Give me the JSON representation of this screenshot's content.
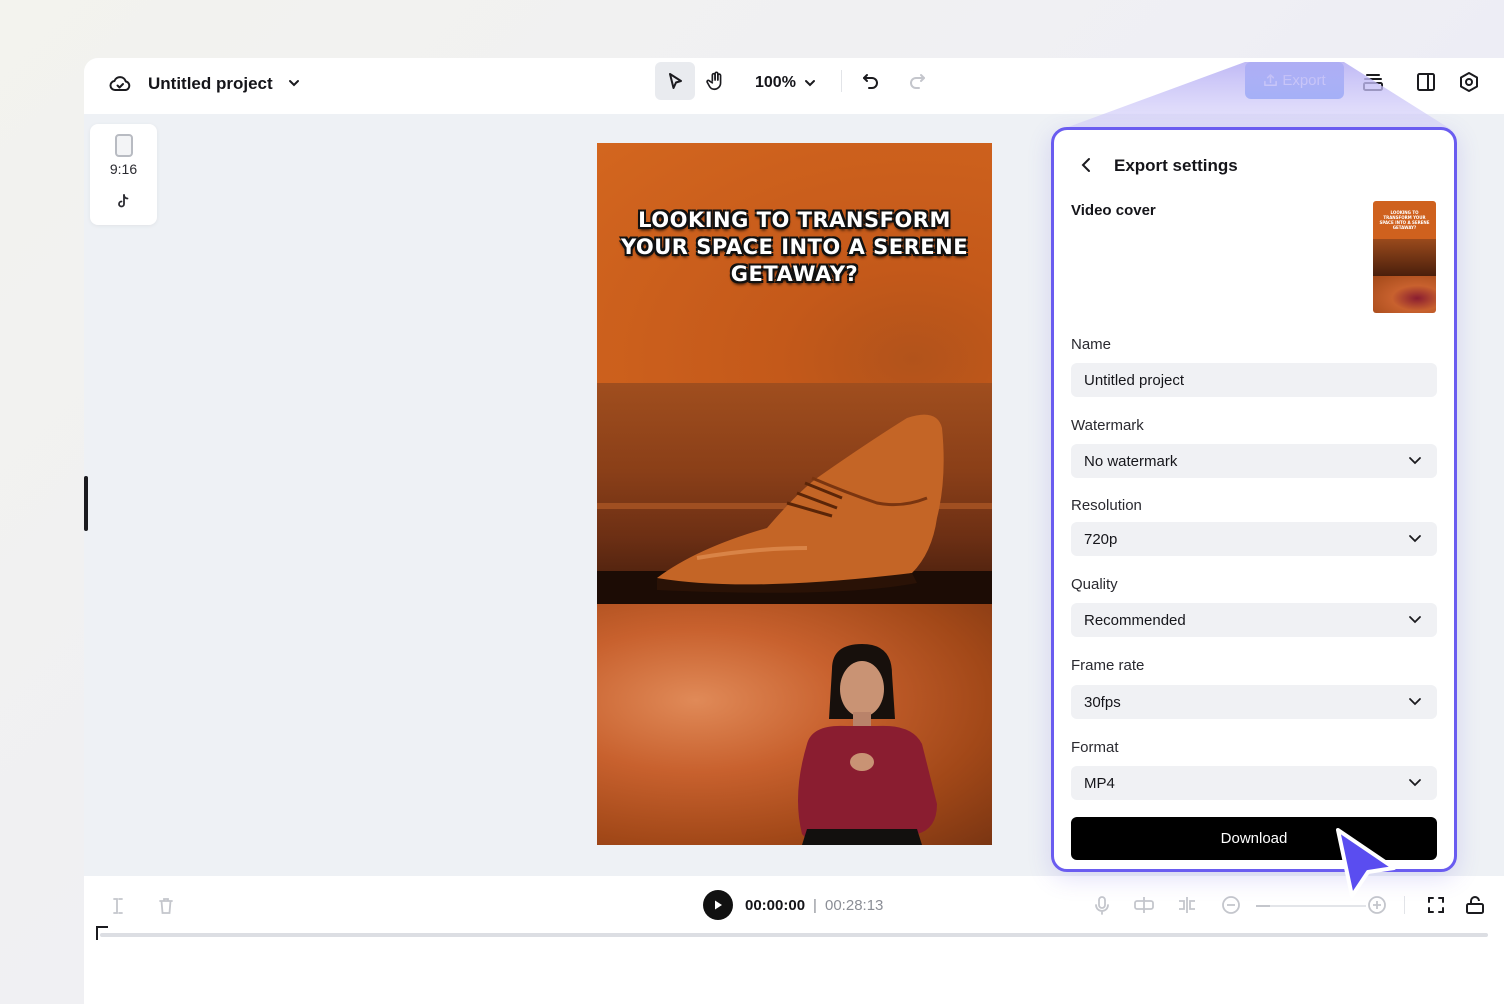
{
  "topbar": {
    "project_title": "Untitled project",
    "zoom": "100%",
    "export_label": "Export"
  },
  "ratio_card": {
    "ratio": "9:16"
  },
  "canvas": {
    "headline": "LOOKING TO TRANSFORM YOUR SPACE INTO A SERENE GETAWAY?"
  },
  "export_panel": {
    "title": "Export settings",
    "video_cover_label": "Video cover",
    "name_label": "Name",
    "name_value": "Untitled project",
    "watermark_label": "Watermark",
    "watermark_value": "No watermark",
    "resolution_label": "Resolution",
    "resolution_value": "720p",
    "quality_label": "Quality",
    "quality_value": "Recommended",
    "framerate_label": "Frame rate",
    "framerate_value": "30fps",
    "format_label": "Format",
    "format_value": "MP4",
    "download_label": "Download"
  },
  "player": {
    "current_time": "00:00:00",
    "separator": "|",
    "duration": "00:28:13"
  },
  "colors": {
    "accent": "#6a5cf0",
    "export_button": "#4c82f7",
    "download_button": "#000000",
    "canvas_orange": "#d3661f"
  }
}
